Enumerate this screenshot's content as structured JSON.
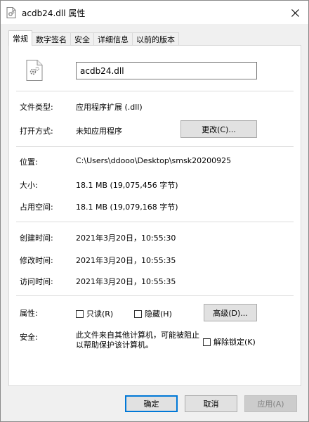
{
  "titlebar": {
    "title": "acdb24.dll 属性"
  },
  "tabs": [
    {
      "label": "常规"
    },
    {
      "label": "数字签名"
    },
    {
      "label": "安全"
    },
    {
      "label": "详细信息"
    },
    {
      "label": "以前的版本"
    }
  ],
  "general": {
    "file_name": "acdb24.dll",
    "file_type_label": "文件类型:",
    "file_type_value": "应用程序扩展 (.dll)",
    "opens_with_label": "打开方式:",
    "opens_with_value": "未知应用程序",
    "change_button": "更改(C)...",
    "location_label": "位置:",
    "location_value": "C:\\Users\\ddooo\\Desktop\\smsk20200925",
    "size_label": "大小:",
    "size_value": "18.1 MB (19,075,456 字节)",
    "size_on_disk_label": "占用空间:",
    "size_on_disk_value": "18.1 MB (19,079,168 字节)",
    "created_label": "创建时间:",
    "created_value": "2021年3月20日，10:55:30",
    "modified_label": "修改时间:",
    "modified_value": "2021年3月20日，10:55:35",
    "accessed_label": "访问时间:",
    "accessed_value": "2021年3月20日，10:55:35",
    "attributes_label": "属性:",
    "readonly_label": "只读(R)",
    "hidden_label": "隐藏(H)",
    "advanced_button": "高级(D)...",
    "security_label": "安全:",
    "security_text_line1": "此文件来自其他计算机，可能被阻止",
    "security_text_line2": "以帮助保护该计算机。",
    "unblock_label": "解除锁定(K)"
  },
  "footer": {
    "ok": "确定",
    "cancel": "取消",
    "apply": "应用(A)"
  }
}
